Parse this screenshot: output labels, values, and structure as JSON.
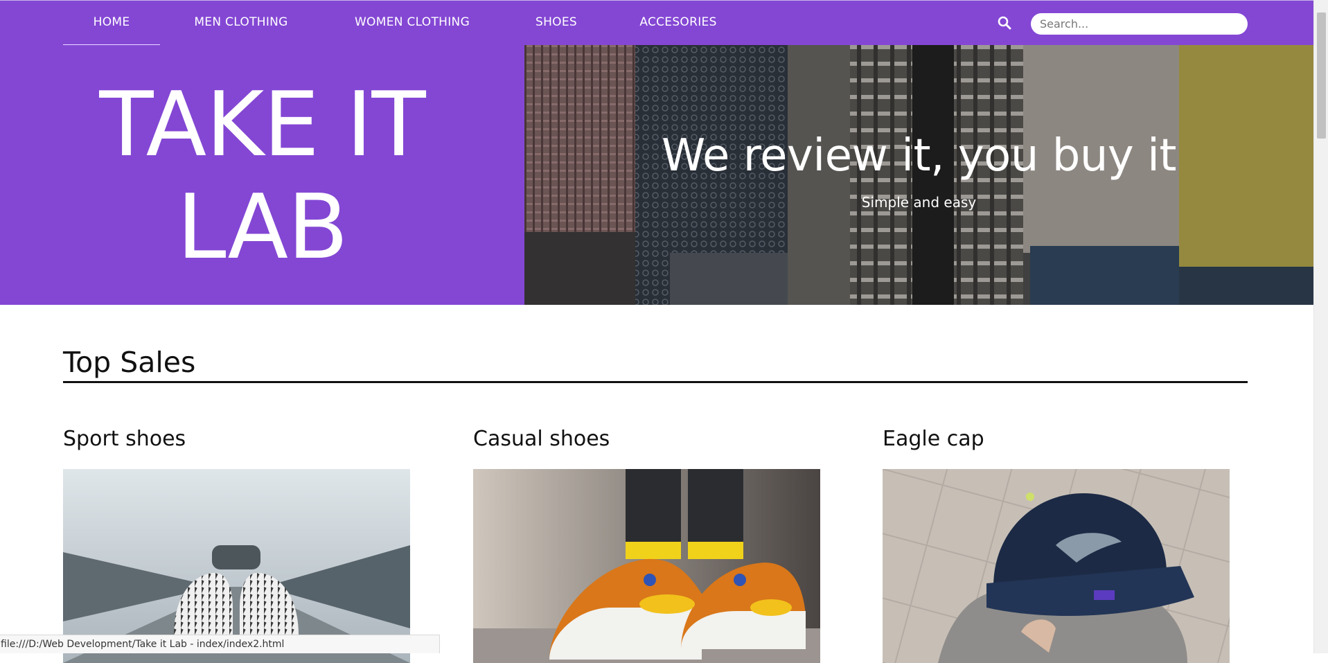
{
  "nav": {
    "items": [
      {
        "label": "HOME",
        "active": true
      },
      {
        "label": "MEN CLOTHING",
        "active": false
      },
      {
        "label": "WOMEN CLOTHING",
        "active": false
      },
      {
        "label": "SHOES",
        "active": false
      },
      {
        "label": "ACCESORIES",
        "active": false
      }
    ],
    "search_icon": "search-icon",
    "search_placeholder": "Search..."
  },
  "hero": {
    "brand_line1": "TAKE IT",
    "brand_line2": "LAB",
    "tagline": "We review it, you buy it",
    "subline": "Simple and easy"
  },
  "top_sales": {
    "title": "Top Sales",
    "products": [
      {
        "title": "Sport shoes"
      },
      {
        "title": "Casual shoes"
      },
      {
        "title": "Eagle cap"
      }
    ]
  },
  "status_bar": {
    "url": "file:///D:/Web Development/Take it Lab - index/index2.html"
  },
  "colors": {
    "brand_purple": "#8447d4",
    "text_dark": "#111111",
    "white": "#ffffff"
  }
}
